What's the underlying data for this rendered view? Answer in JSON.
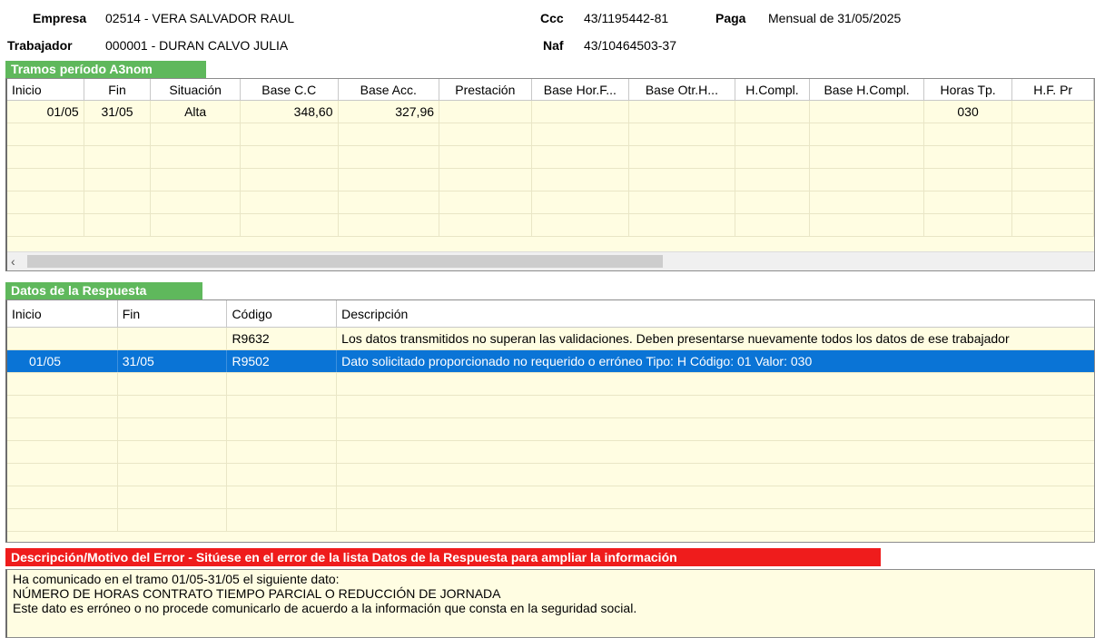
{
  "header": {
    "empresa_label": "Empresa",
    "empresa_value": "02514 - VERA SALVADOR RAUL",
    "trabajador_label": "Trabajador",
    "trabajador_value": "000001 - DURAN CALVO JULIA",
    "ccc_label": "Ccc",
    "ccc_value": "43/1195442-81",
    "naf_label": "Naf",
    "naf_value": "43/10464503-37",
    "paga_label": "Paga",
    "paga_value": "Mensual de 31/05/2025"
  },
  "tramos": {
    "tab_label": "Tramos período A3nom",
    "columns": [
      "Inicio",
      "Fin",
      "Situación",
      "Base C.C",
      "Base Acc.",
      "Prestación",
      "Base Hor.F...",
      "Base Otr.H...",
      "H.Compl.",
      "Base H.Compl.",
      "Horas Tp.",
      "H.F. Pr"
    ],
    "rows": [
      [
        "01/05",
        "31/05",
        "Alta",
        "348,60",
        "327,96",
        "",
        "",
        "",
        "",
        "",
        "030",
        ""
      ]
    ],
    "scroll_left_icon": "chevron-left-icon"
  },
  "respuesta": {
    "tab_label": "Datos de la Respuesta",
    "columns": [
      "Inicio",
      "Fin",
      "Código",
      "Descripción"
    ],
    "rows": [
      [
        "",
        "",
        "R9632",
        "Los datos transmitidos no superan las validaciones. Deben presentarse nuevamente todos los datos de ese trabajador"
      ],
      [
        "01/05",
        "31/05",
        "R9502",
        "Dato solicitado proporcionado no requerido o erróneo Tipo: H Código: 01  Valor: 030"
      ]
    ],
    "selected_row": 1
  },
  "error": {
    "tab_label": "Descripción/Motivo del Error - Sitúese en el error de la lista Datos de la Respuesta para ampliar la información",
    "lines": [
      "Ha comunicado en el tramo 01/05-31/05 el siguiente dato:",
      "NÚMERO DE HORAS CONTRATO TIEMPO PARCIAL O REDUCCIÓN DE JORNADA",
      "Este dato es erróneo o no procede comunicarlo de acuerdo a la información que consta en la seguridad social."
    ]
  },
  "colors": {
    "tab_green": "#5fb85c",
    "tab_red": "#ef1c1c",
    "grid_background": "#fffde2",
    "selection": "#0a74d6"
  }
}
